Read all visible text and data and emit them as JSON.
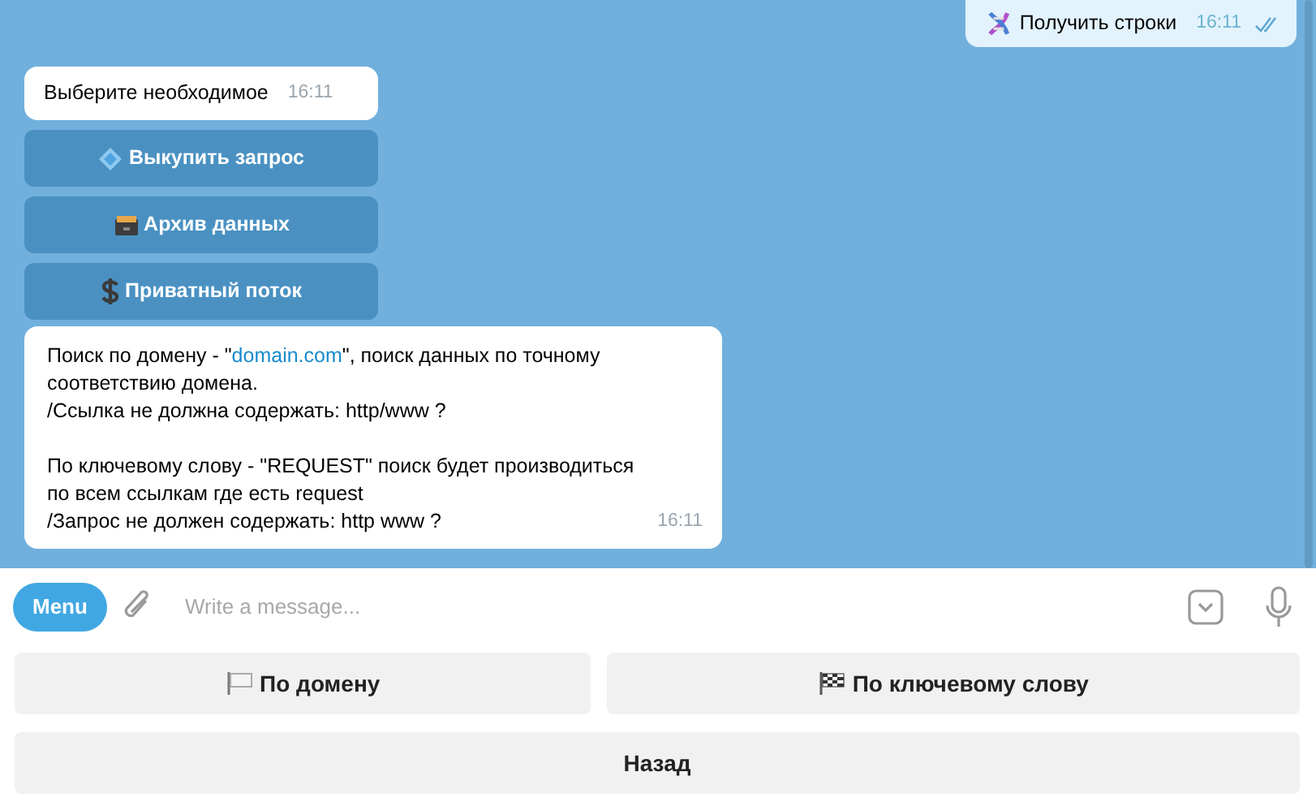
{
  "messages": [
    {
      "kind": "outgoing",
      "text": "Получить строки",
      "time": "16:11",
      "read": true
    },
    {
      "kind": "incoming",
      "text": "Выберите необходимое",
      "time": "16:11",
      "buttons": [
        {
          "label": "Выкупить запрос"
        },
        {
          "label": "Архив данных"
        },
        {
          "label": "Приватный поток"
        }
      ]
    },
    {
      "kind": "incoming",
      "time": "16:11",
      "paragraphs": [
        {
          "segments": [
            {
              "kind": "text",
              "text": "Поиск по домену - \""
            },
            {
              "kind": "link",
              "text": "domain.com"
            },
            {
              "kind": "text",
              "text": "\", поиск данных по точному соответствию домена.\n/Ссылка не должна содержать: http/www  ?"
            }
          ]
        },
        {
          "segments": [
            {
              "kind": "text",
              "text": "По ключевому слову - \"REQUEST\" поиск будет производиться по всем ссылкам где есть request\n/Запрос не должен содержать: http www  ?"
            }
          ]
        }
      ]
    }
  ],
  "composer": {
    "menu_label": "Menu",
    "placeholder": "Write a message..."
  },
  "keyboard": [
    [
      {
        "label": "По домену"
      },
      {
        "label": "По ключевому слову"
      }
    ],
    [
      {
        "label": "Назад"
      }
    ]
  ]
}
